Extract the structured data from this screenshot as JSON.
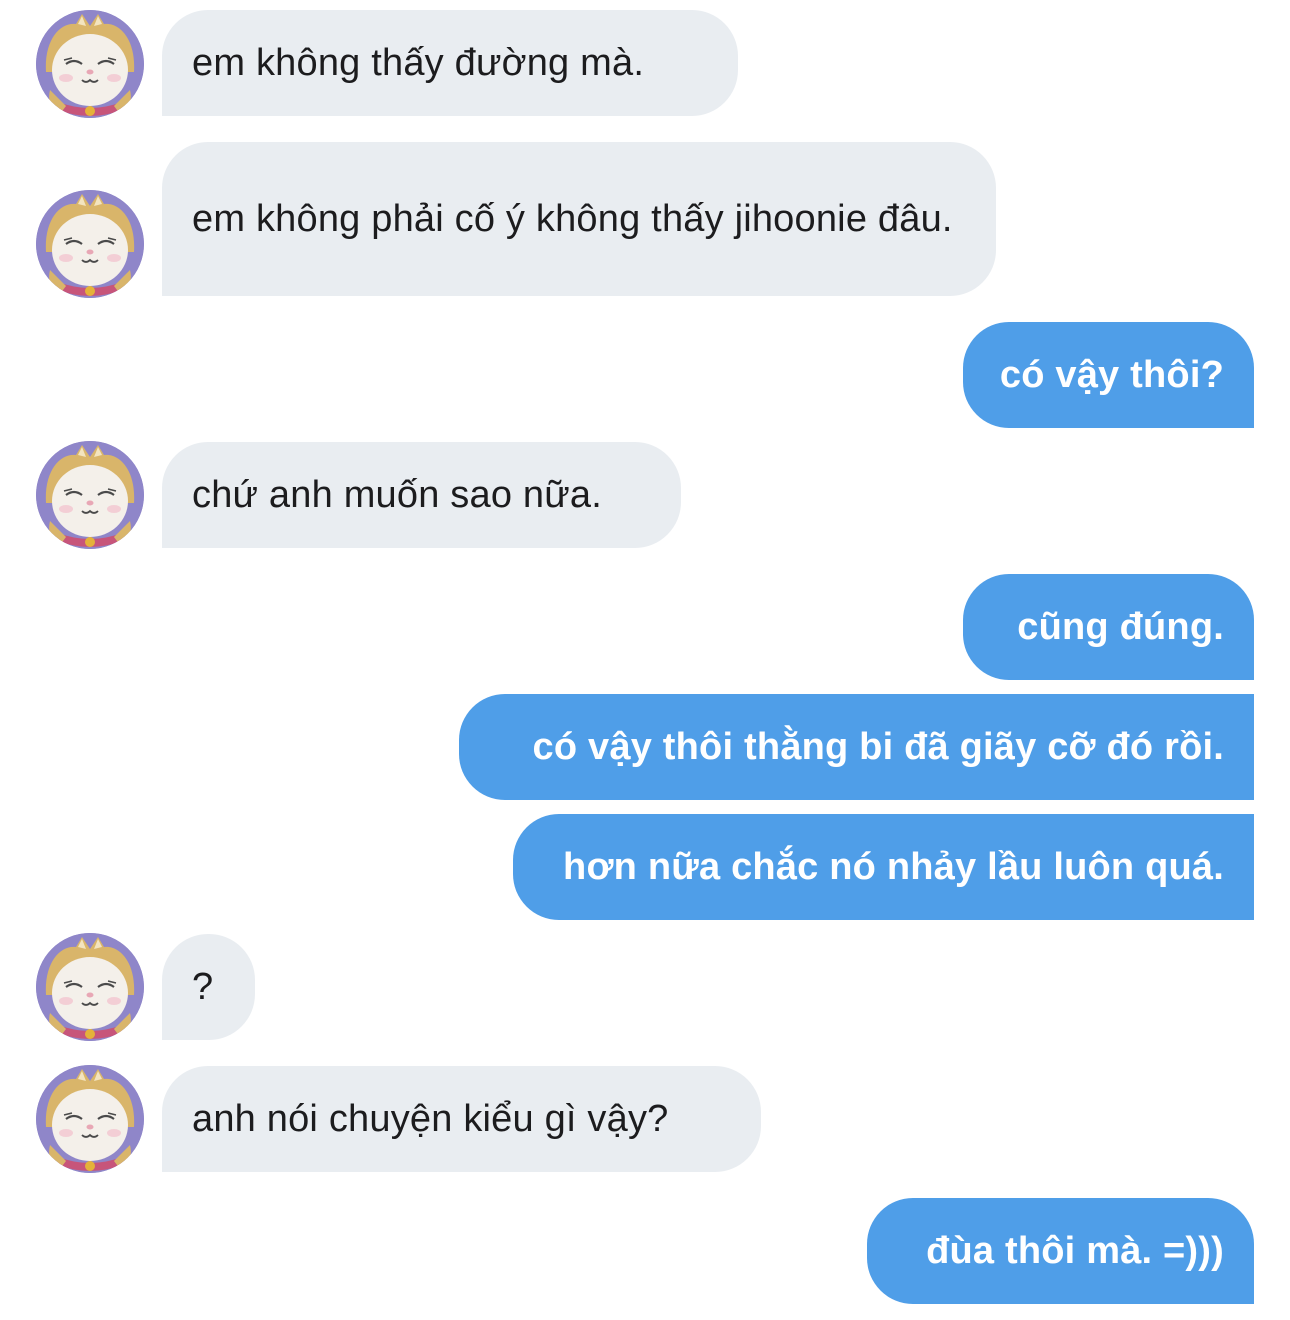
{
  "conversation": {
    "messages": [
      {
        "side": "in",
        "text": "em không thấy đường mà."
      },
      {
        "side": "in",
        "text": "em không phải cố ý không thấy jihoonie đâu."
      },
      {
        "side": "out",
        "text": "có vậy thôi?"
      },
      {
        "side": "in",
        "text": "chứ anh muốn sao nữa."
      },
      {
        "side": "out",
        "text": "cũng đúng."
      },
      {
        "side": "out",
        "text": "có vậy thôi thằng bi đã giãy cỡ đó rồi."
      },
      {
        "side": "out",
        "text": "hơn nữa chắc nó nhảy lầu luôn quá."
      },
      {
        "side": "in",
        "text": "?"
      },
      {
        "side": "in",
        "text": "anh nói chuyện kiểu gì vậy?"
      },
      {
        "side": "out",
        "text": "đùa thôi mà. =)))"
      }
    ]
  },
  "avatar": {
    "icon": "cat-hood-avatar-icon"
  },
  "colors": {
    "incoming_bubble": "#e9edf1",
    "outgoing_bubble": "#4f9ee8",
    "incoming_text": "#1c1c1e",
    "outgoing_text": "#ffffff"
  }
}
